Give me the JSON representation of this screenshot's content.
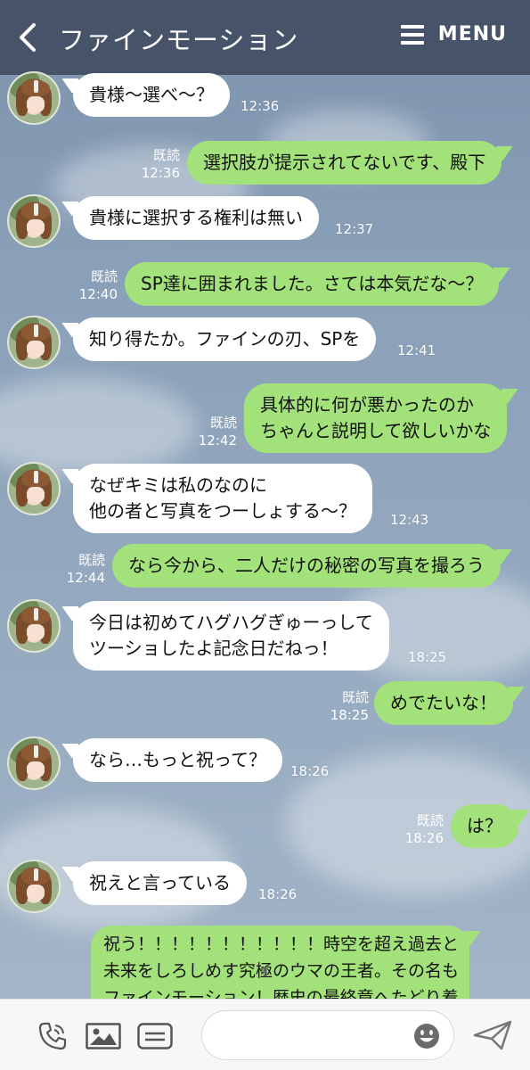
{
  "header": {
    "title": "ファインモーション",
    "menu_label": "MENU"
  },
  "messages": [
    {
      "dir": "in",
      "text": "貴様〜選べ〜？",
      "time": "12:36"
    },
    {
      "dir": "out",
      "text": "選択肢が提示されてないです、殿下",
      "read": "既読",
      "time": "12:36"
    },
    {
      "dir": "in",
      "text": "貴様に選択する権利は無い",
      "time": "12:37"
    },
    {
      "dir": "out",
      "text": "SP達に囲まれました。さては本気だな〜？",
      "read": "既読",
      "time": "12:40"
    },
    {
      "dir": "in",
      "text": "知り得たか。ファインの刃、SPを",
      "time": "12:41"
    },
    {
      "dir": "out",
      "text": "具体的に何が悪かったのか\nちゃんと説明して欲しいかな",
      "read": "既読",
      "time": "12:42"
    },
    {
      "dir": "in",
      "text": "なぜキミは私のなのに\n他の者と写真をつーしょする〜？",
      "time": "12:43"
    },
    {
      "dir": "out",
      "text": "なら今から、二人だけの秘密の写真を撮ろう",
      "read": "既読",
      "time": "12:44"
    },
    {
      "dir": "in",
      "text": "今日は初めてハグハグぎゅーっして\nツーショしたよ記念日だねっ！",
      "time": "18:25"
    },
    {
      "dir": "out",
      "text": "めでたいな！",
      "read": "既読",
      "time": "18:25"
    },
    {
      "dir": "in",
      "text": "なら…もっと祝って？",
      "time": "18:26"
    },
    {
      "dir": "out",
      "text": "は？",
      "read": "既読",
      "time": "18:26"
    },
    {
      "dir": "in",
      "text": "祝えと言っている",
      "time": "18:26"
    },
    {
      "dir": "out",
      "text": "祝う！！！！！！！！！！！時空を超え過去と\n未来をしろしめす究極のウマの王者。その名も\nファインモーション！歴史の最終章へたどり着"
    }
  ],
  "footer": {
    "input_placeholder": ""
  },
  "icons": {
    "back": "chevron-left-icon",
    "menu": "hamburger-icon",
    "call": "phone-icon",
    "image": "image-icon",
    "stamp": "sticker-icon",
    "emoji": "emoji-icon",
    "send": "send-icon"
  },
  "colors": {
    "header": "#475369",
    "bubble_out": "#a3e27a",
    "bubble_in": "#ffffff"
  }
}
